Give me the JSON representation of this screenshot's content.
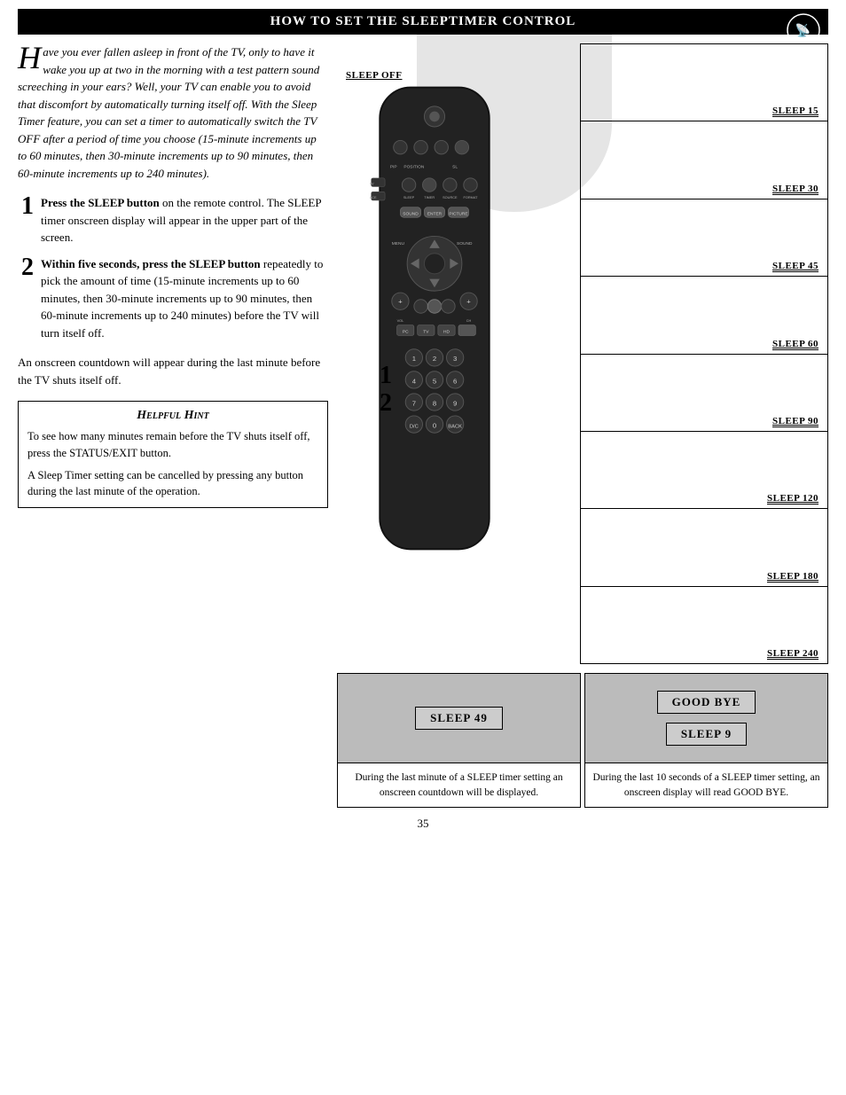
{
  "header": {
    "title": "How to Set the Sleeptimer Control"
  },
  "intro": {
    "drop_cap": "H",
    "text": "ave you ever fallen asleep in front of the TV, only to have it wake you up at two in the morning with a test pattern sound screeching in your ears?  Well, your TV can enable you to avoid that discomfort by automatically turning itself off. With the Sleep Timer feature, you can set a timer to automatically switch the TV OFF after a period of time you choose (15-minute increments up to 60 minutes, then 30-minute increments up to 90 minutes, then 60-minute increments up to 240 minutes)."
  },
  "steps": [
    {
      "number": "1",
      "bold_text": "Press the SLEEP button",
      "text": " on the remote control.  The SLEEP timer onscreen display will appear in the upper part of the screen."
    },
    {
      "number": "2",
      "bold_text": "Within five seconds, press the SLEEP button",
      "text": " repeatedly to pick the amount of time (15-minute increments up to 60 minutes, then 30-minute increments up to 90 minutes, then 60-minute increments up to 240 minutes) before the TV will turn itself off."
    }
  ],
  "countdown_note": "An onscreen countdown will appear during the last minute before the TV shuts itself off.",
  "helpful_hint": {
    "title": "Helpful Hint",
    "paragraphs": [
      "To see how many minutes remain before the TV shuts itself off, press the STATUS/EXIT button.",
      "A Sleep Timer setting can be cancelled by pressing any button during the last minute of the operation."
    ]
  },
  "sleep_labels": [
    "SLEEP OFF",
    "SLEEP 15",
    "SLEEP 30",
    "SLEEP 45",
    "SLEEP 60",
    "SLEEP 90",
    "SLEEP 120",
    "SLEEP 180",
    "SLEEP 240"
  ],
  "bottom_screens": [
    {
      "display_text": "SLEEP 49",
      "caption": "During the last minute of a SLEEP timer setting an onscreen countdown will be displayed."
    },
    {
      "display_text1": "GOOD BYE",
      "display_text2": "SLEEP 9",
      "caption": "During the last 10 seconds of a SLEEP timer setting, an onscreen display will read GOOD BYE."
    }
  ],
  "page_number": "35"
}
